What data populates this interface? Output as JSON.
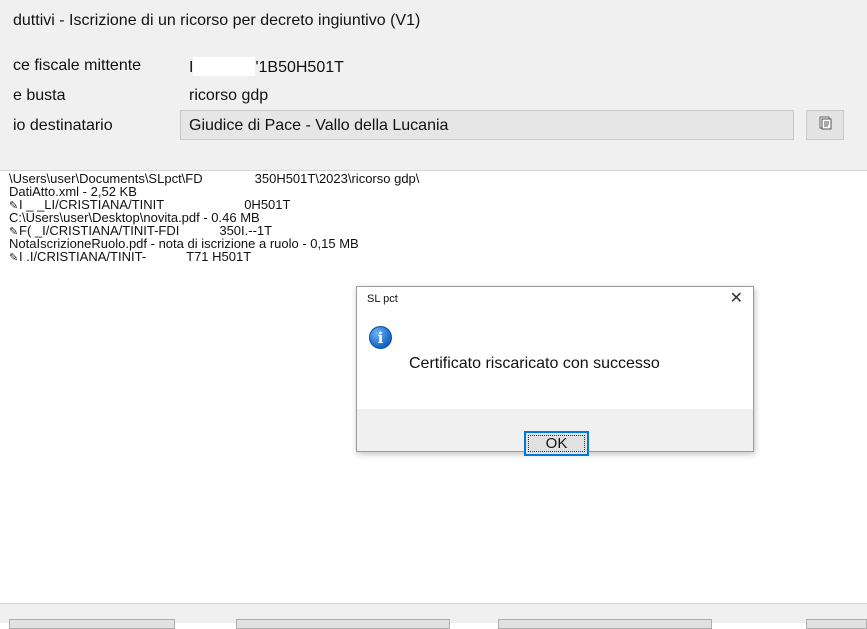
{
  "window": {
    "title": "duttivi - Iscrizione di un ricorso per decreto ingiuntivo (V1)"
  },
  "form": {
    "sender_label": "ce fiscale mittente",
    "sender_value_prefix": "I",
    "sender_value_suffix": "'1B50H501T",
    "envelope_label": "e busta",
    "envelope_value": "ricorso gdp",
    "recipient_label": "io destinatario",
    "recipient_value": "Giudice di Pace - Vallo della Lucania",
    "browse_icon": "document-list-icon"
  },
  "files": {
    "lines": [
      {
        "icon": "",
        "a": "\\Users\\user\\Documents\\SLpct\\FD",
        "b": "350H501T\\2023\\ricorso gdp\\"
      },
      {
        "icon": "",
        "a": "DatiAtto.xml - 2,52 KB",
        "b": ""
      },
      {
        "icon": "pencil-icon",
        "a": "I  _ _LI/CRISTIANA/TINIT",
        "b": "0H501T"
      },
      {
        "icon": "",
        "a": "C:\\Users\\user\\Desktop\\novita.pdf - 0.46 MB",
        "b": ""
      },
      {
        "icon": "pencil-icon",
        "a": "F(    _I/CRISTIANA/TINIT-FDI",
        "b": "350I.--1T"
      },
      {
        "icon": "",
        "a": "NotaIscrizioneRuolo.pdf - nota di iscrizione a ruolo - 0,15 MB",
        "b": ""
      },
      {
        "icon": "pencil-icon",
        "a": "I     .I/CRISTIANA/TINIT-",
        "b": "T71      H501T"
      }
    ]
  },
  "dialog": {
    "title": "SL pct",
    "close_glyph": "✕",
    "icon": "info-icon",
    "icon_glyph": "i",
    "message": "Certificato riscaricato con successo",
    "ok_label": "OK"
  }
}
